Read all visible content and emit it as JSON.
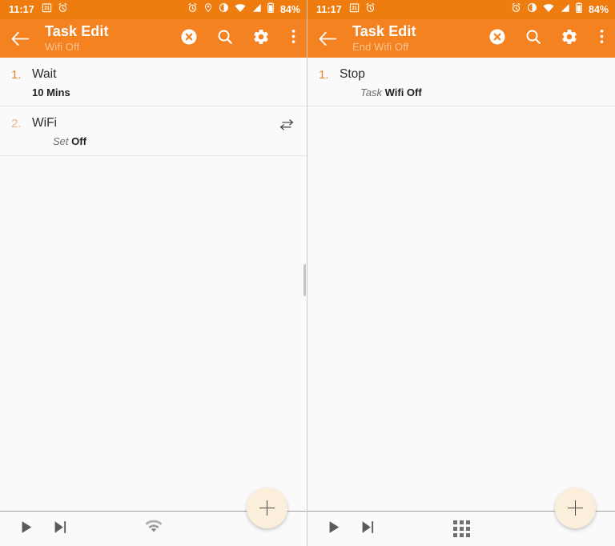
{
  "panels": [
    {
      "id": "left",
      "statusbar": {
        "time": "11:17",
        "battery_text": "84%",
        "left_icons": [
          "calendar-31-icon",
          "alarm-clock-icon"
        ],
        "right_icons": [
          "alarm-clock-icon",
          "location-pin-icon",
          "vibrate-icon",
          "wifi-icon",
          "signal-icon",
          "battery-icon"
        ]
      },
      "toolbar": {
        "back_icon": "back-arrow-icon",
        "title": "Task Edit",
        "subtitle": "Wifi Off",
        "actions": [
          {
            "name": "cancel-button",
            "icon": "circle-x-icon"
          },
          {
            "name": "search-button",
            "icon": "search-icon"
          },
          {
            "name": "settings-button",
            "icon": "gear-icon"
          },
          {
            "name": "overflow-menu-button",
            "icon": "more-vertical-icon"
          }
        ]
      },
      "items": [
        {
          "number": "1.",
          "number_style": "strong",
          "title": "Wait",
          "sub_label": "",
          "sub_value": "10 Mins",
          "right_icon": ""
        },
        {
          "number": "2.",
          "number_style": "faded",
          "title": "WiFi",
          "sub_label": "Set",
          "sub_value": "Off",
          "right_icon": "swap-arrows-icon"
        }
      ],
      "bottombar": {
        "buttons": [
          {
            "name": "play-button",
            "icon": "play-icon"
          },
          {
            "name": "step-forward-button",
            "icon": "step-forward-icon"
          }
        ],
        "center_icon": "wifi-icon",
        "fab": {
          "name": "add-action-fab",
          "icon": "plus-icon"
        }
      }
    },
    {
      "id": "right",
      "statusbar": {
        "time": "11:17",
        "battery_text": "84%",
        "left_icons": [
          "calendar-31-icon",
          "alarm-clock-icon"
        ],
        "right_icons": [
          "alarm-clock-icon",
          "vibrate-icon",
          "wifi-icon",
          "signal-icon",
          "battery-icon"
        ]
      },
      "toolbar": {
        "back_icon": "back-arrow-icon",
        "title": "Task Edit",
        "subtitle": "End Wifi Off",
        "actions": [
          {
            "name": "cancel-button",
            "icon": "circle-x-icon"
          },
          {
            "name": "search-button",
            "icon": "search-icon"
          },
          {
            "name": "settings-button",
            "icon": "gear-icon"
          },
          {
            "name": "overflow-menu-button",
            "icon": "more-vertical-icon"
          }
        ]
      },
      "items": [
        {
          "number": "1.",
          "number_style": "strong",
          "title": "Stop",
          "sub_label": "Task",
          "sub_value": "Wifi Off",
          "right_icon": ""
        }
      ],
      "bottombar": {
        "buttons": [
          {
            "name": "play-button",
            "icon": "play-icon"
          },
          {
            "name": "step-forward-button",
            "icon": "step-forward-icon"
          }
        ],
        "center_icon": "grid-icon",
        "fab": {
          "name": "add-action-fab",
          "icon": "plus-icon"
        }
      }
    }
  ],
  "colors": {
    "statusbar_orange": "#EE7C0E",
    "toolbar_orange": "#F58220",
    "subtitle_orange": "#FBC392",
    "accent_number": "#E8872A",
    "accent_number_faded": "#F3B878",
    "fab_cream": "#FBEFDC",
    "content_bg": "#FAFAFA"
  }
}
